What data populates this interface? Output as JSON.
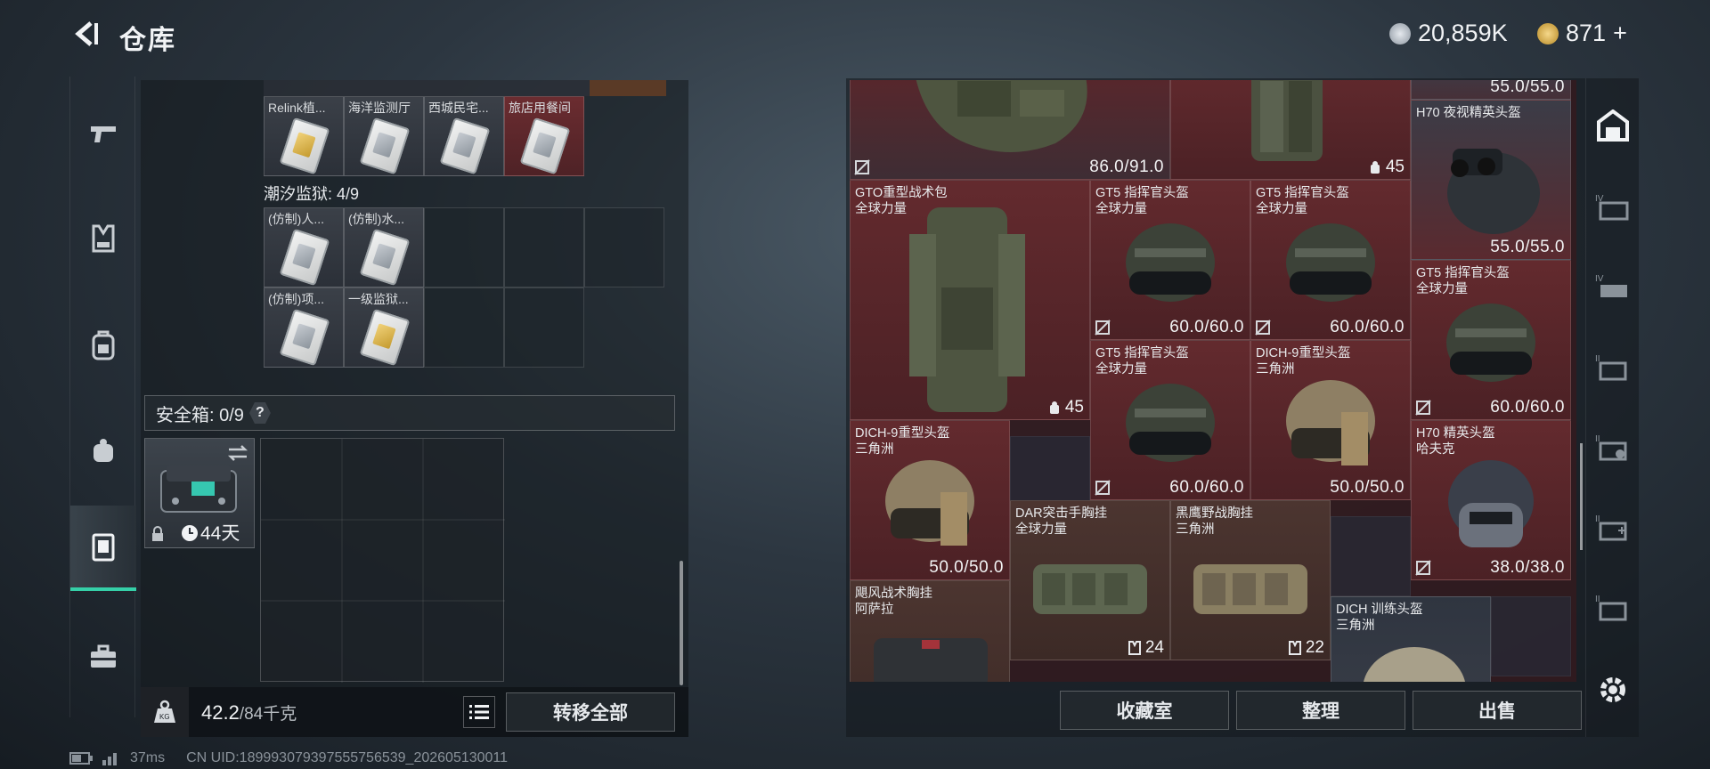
{
  "header": {
    "title": "仓库"
  },
  "currency": {
    "silver": "20,859K",
    "gold": "871",
    "gold_plus": "+"
  },
  "left": {
    "row1_labels": [
      "Relink植...",
      "海洋监测厅",
      "西城民宅...",
      "旅店用餐间"
    ],
    "prison_label": "潮汐监狱: 4/9",
    "prison_items": [
      "(仿制)人...",
      "(仿制)水...",
      "(仿制)项...",
      "一级监狱..."
    ],
    "safe_label": "安全箱: 0/9",
    "safe_help": "?",
    "safe_timer": "44天",
    "weight_current": "42.2",
    "weight_max": "/84千克",
    "transfer_all": "转移全部"
  },
  "status": {
    "ping": "37ms",
    "uid": "CN UID:189993079397555756539_202605130011"
  },
  "right": {
    "items": [
      {
        "id": "top-vest",
        "dur": "86.0/91.0"
      },
      {
        "id": "top-bag",
        "count": "45"
      },
      {
        "id": "top-right",
        "dur": "55.0/55.0"
      },
      {
        "id": "h70-nv",
        "n1": "H70 夜视精英头盔",
        "dur": "55.0/55.0"
      },
      {
        "id": "gto-bag",
        "n1": "GTO重型战术包",
        "n2": "全球力量",
        "count": "45"
      },
      {
        "id": "gt5-a",
        "n1": "GT5 指挥官头盔",
        "n2": "全球力量",
        "dur": "60.0/60.0"
      },
      {
        "id": "gt5-b",
        "n1": "GT5 指挥官头盔",
        "n2": "全球力量",
        "dur": "60.0/60.0"
      },
      {
        "id": "gt5-c",
        "n1": "GT5 指挥官头盔",
        "n2": "全球力量",
        "dur": "60.0/60.0"
      },
      {
        "id": "gt5-d",
        "n1": "GT5 指挥官头盔",
        "n2": "全球力量",
        "dur": "60.0/60.0"
      },
      {
        "id": "dich9-a",
        "n1": "DICH-9重型头盔",
        "n2": "三角洲",
        "dur": "50.0/50.0"
      },
      {
        "id": "dich9-b",
        "n1": "DICH-9重型头盔",
        "n2": "三角洲",
        "dur": "50.0/50.0"
      },
      {
        "id": "h70-elite",
        "n1": "H70 精英头盔",
        "n2": "哈夫克",
        "dur": "38.0/38.0"
      },
      {
        "id": "dar",
        "n1": "DAR突击手胸挂",
        "n2": "全球力量",
        "count": "24"
      },
      {
        "id": "blackhawk",
        "n1": "黑鹰野战胸挂",
        "n2": "三角洲",
        "count": "22"
      },
      {
        "id": "typhoon",
        "n1": "飓风战术胸挂",
        "n2": "阿萨拉"
      },
      {
        "id": "dich-train",
        "n1": "DICH 训练头盔",
        "n2": "三角洲"
      }
    ],
    "btn_collection": "收藏室",
    "btn_sort": "整理",
    "btn_sell": "出售"
  },
  "colors": {
    "accent": "#35d0a8",
    "item_red": "#5a262a"
  }
}
